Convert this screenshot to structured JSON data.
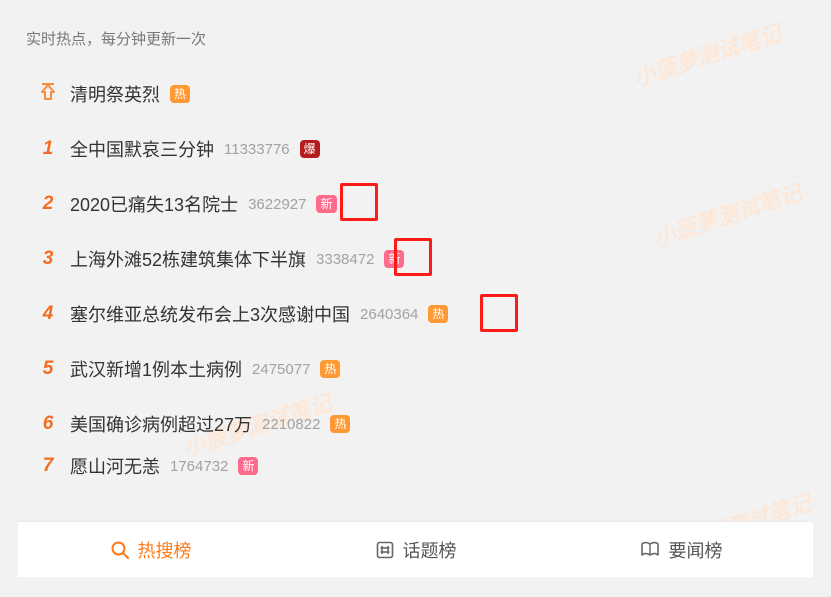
{
  "watermark": "小菠萝测试笔记",
  "header": "实时热点，每分钟更新一次",
  "badges": {
    "hot": "热",
    "new": "新",
    "boom": "爆"
  },
  "list": {
    "pinned": {
      "title": "清明祭英烈",
      "badge": "hot"
    },
    "items": [
      {
        "rank": "1",
        "title": "全中国默哀三分钟",
        "count": "11333776",
        "badge": "boom"
      },
      {
        "rank": "2",
        "title": "2020已痛失13名院士",
        "count": "3622927",
        "badge": "new"
      },
      {
        "rank": "3",
        "title": "上海外滩52栋建筑集体下半旗",
        "count": "3338472",
        "badge": "new"
      },
      {
        "rank": "4",
        "title": "塞尔维亚总统发布会上3次感谢中国",
        "count": "2640364",
        "badge": "hot"
      },
      {
        "rank": "5",
        "title": "武汉新增1例本土病例",
        "count": "2475077",
        "badge": "hot"
      },
      {
        "rank": "6",
        "title": "美国确诊病例超过27万",
        "count": "2210822",
        "badge": "hot"
      },
      {
        "rank": "7",
        "title": "愿山河无恙",
        "count": "1764732",
        "badge": "new"
      }
    ]
  },
  "tabs": {
    "hot_search": "热搜榜",
    "topics": "话题榜",
    "news": "要闻榜"
  }
}
